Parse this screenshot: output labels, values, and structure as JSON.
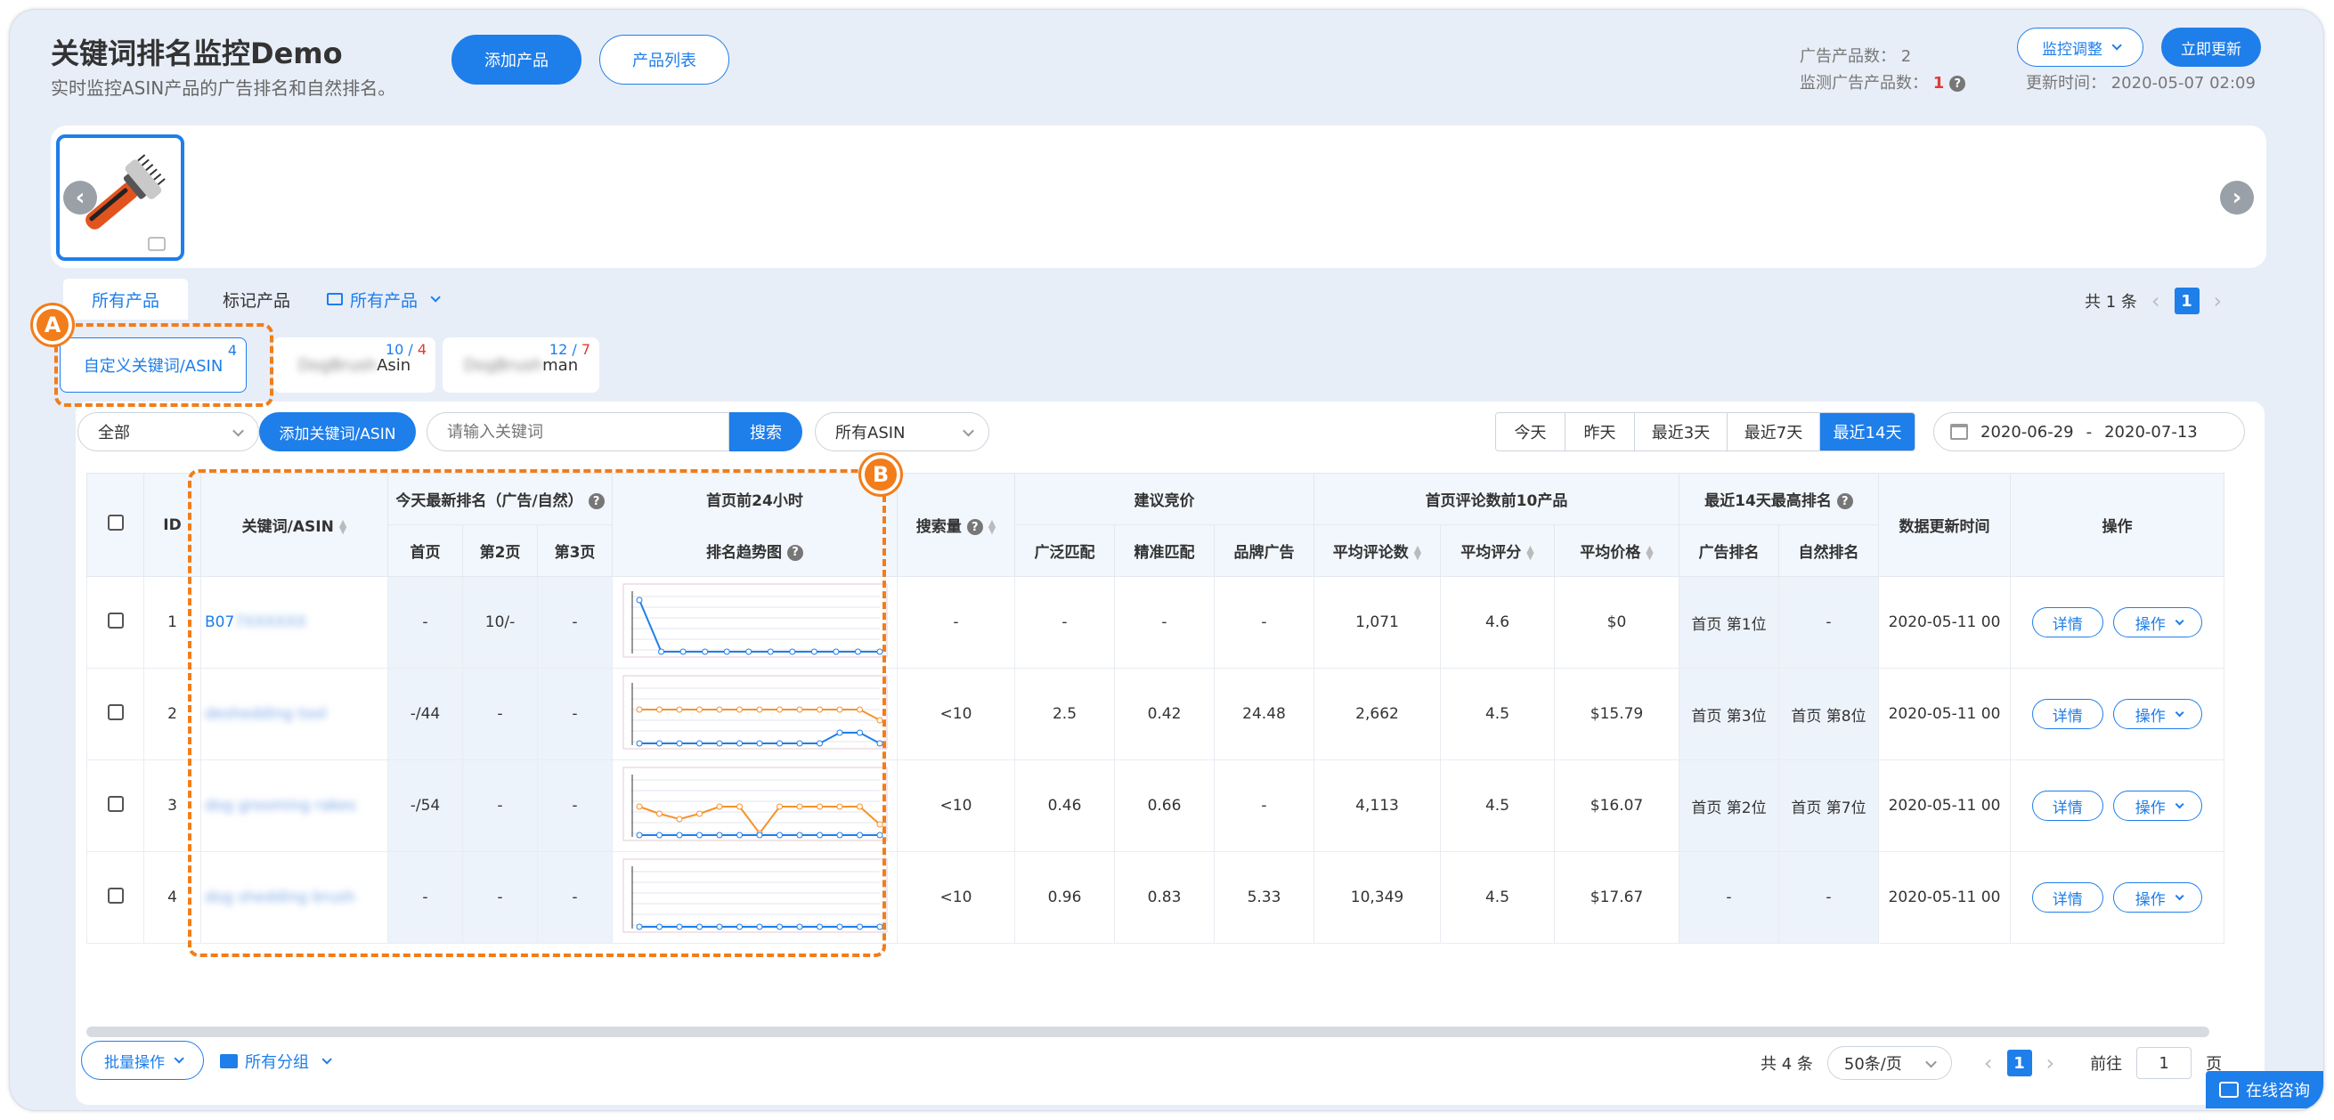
{
  "header": {
    "title": "关键词排名监控Demo",
    "subtitle": "实时监控ASIN产品的广告排名和自然排名。",
    "add_product": "添加产品",
    "product_list": "产品列表",
    "ad_product_label": "广告产品数：",
    "ad_product_count": "2",
    "monitored_label": "监测广告产品数：",
    "monitored_count": "1",
    "monitor_adjust": "监控调整",
    "update_now": "立即更新",
    "update_time_label": "更新时间：",
    "update_time": "2020-05-07 02:09"
  },
  "tabs": {
    "all_products": "所有产品",
    "marked_products": "标记产品",
    "group": "所有产品",
    "total": "共 1 条",
    "page": "1"
  },
  "kw_tabs": [
    {
      "label": "自定义关键词/ASIN",
      "count": "4",
      "count_red": ""
    },
    {
      "label_blur": "DogBrush",
      "label": "Asin",
      "count": "10 / ",
      "count_red": "4"
    },
    {
      "label_blur": "DogBrush",
      "label": "man",
      "count": "12 / ",
      "count_red": "7"
    }
  ],
  "markers": {
    "a": "A",
    "b": "B"
  },
  "toolbar": {
    "filter_all": "全部",
    "add_kw": "添加关键词/ASIN",
    "search_placeholder": "请输入关键词",
    "search_btn": "搜索",
    "asin_filter": "所有ASIN",
    "ranges": [
      "今天",
      "昨天",
      "最近3天",
      "最近7天",
      "最近14天"
    ],
    "active_range": "最近14天",
    "date_from": "2020-06-29",
    "date_sep": "-",
    "date_to": "2020-07-13"
  },
  "table": {
    "headers": {
      "id": "ID",
      "keyword": "关键词/ASIN",
      "today_rank": "今天最新排名（广告/自然）",
      "p1": "首页",
      "p2": "第2页",
      "p3": "第3页",
      "trend_1": "首页前24小时",
      "trend_2": "排名趋势图",
      "search_volume": "搜索量",
      "bid": "建议竞价",
      "broad": "广泛匹配",
      "exact": "精准匹配",
      "brand": "品牌广告",
      "top10": "首页评论数前10产品",
      "avg_reviews": "平均评论数",
      "avg_rating": "平均评分",
      "avg_price": "平均价格",
      "best14": "最近14天最高排名",
      "ad_rank": "广告排名",
      "organic_rank": "自然排名",
      "updated": "数据更新时间",
      "ops": "操作"
    },
    "rows": [
      {
        "id": "1",
        "kw": "B07",
        "kw_blur": "7XXXXXX",
        "p1": "-",
        "p2": "10/-",
        "p3": "-",
        "vol": "-",
        "broad": "-",
        "exact": "-",
        "brand": "-",
        "reviews": "1,071",
        "rating": "4.6",
        "price": "$0",
        "ad": "首页 第1位",
        "org": "-",
        "updated": "2020-05-11 00",
        "detail": "详情",
        "op": "操作"
      },
      {
        "id": "2",
        "kw": "",
        "kw_blur": "deshedding tool",
        "p1": "-/44",
        "p2": "-",
        "p3": "-",
        "vol": "<10",
        "broad": "2.5",
        "exact": "0.42",
        "brand": "24.48",
        "reviews": "2,662",
        "rating": "4.5",
        "price": "$15.79",
        "ad": "首页 第3位",
        "org": "首页 第8位",
        "updated": "2020-05-11 00",
        "detail": "详情",
        "op": "操作"
      },
      {
        "id": "3",
        "kw": "",
        "kw_blur": "dog grooming rakes",
        "p1": "-/54",
        "p2": "-",
        "p3": "-",
        "vol": "<10",
        "broad": "0.46",
        "exact": "0.66",
        "brand": "-",
        "reviews": "4,113",
        "rating": "4.5",
        "price": "$16.07",
        "ad": "首页 第2位",
        "org": "首页 第7位",
        "updated": "2020-05-11 00",
        "detail": "详情",
        "op": "操作"
      },
      {
        "id": "4",
        "kw": "",
        "kw_blur": "dog shedding brush",
        "p1": "-",
        "p2": "-",
        "p3": "-",
        "vol": "<10",
        "broad": "0.96",
        "exact": "0.83",
        "brand": "5.33",
        "reviews": "10,349",
        "rating": "4.5",
        "price": "$17.67",
        "ad": "-",
        "org": "-",
        "updated": "2020-05-11 00",
        "detail": "详情",
        "op": "操作"
      }
    ]
  },
  "footer": {
    "batch": "批量操作",
    "groups": "所有分组",
    "total": "共 4 条",
    "page_size": "50条/页",
    "page": "1",
    "goto": "前往",
    "goto_val": "1",
    "page_unit": "页",
    "chat": "在线咨询"
  },
  "colors": {
    "accent": "#1e7eea",
    "marker": "#f27d1a",
    "ad_series": "#1e7eea",
    "organic_series": "#f5922b"
  }
}
